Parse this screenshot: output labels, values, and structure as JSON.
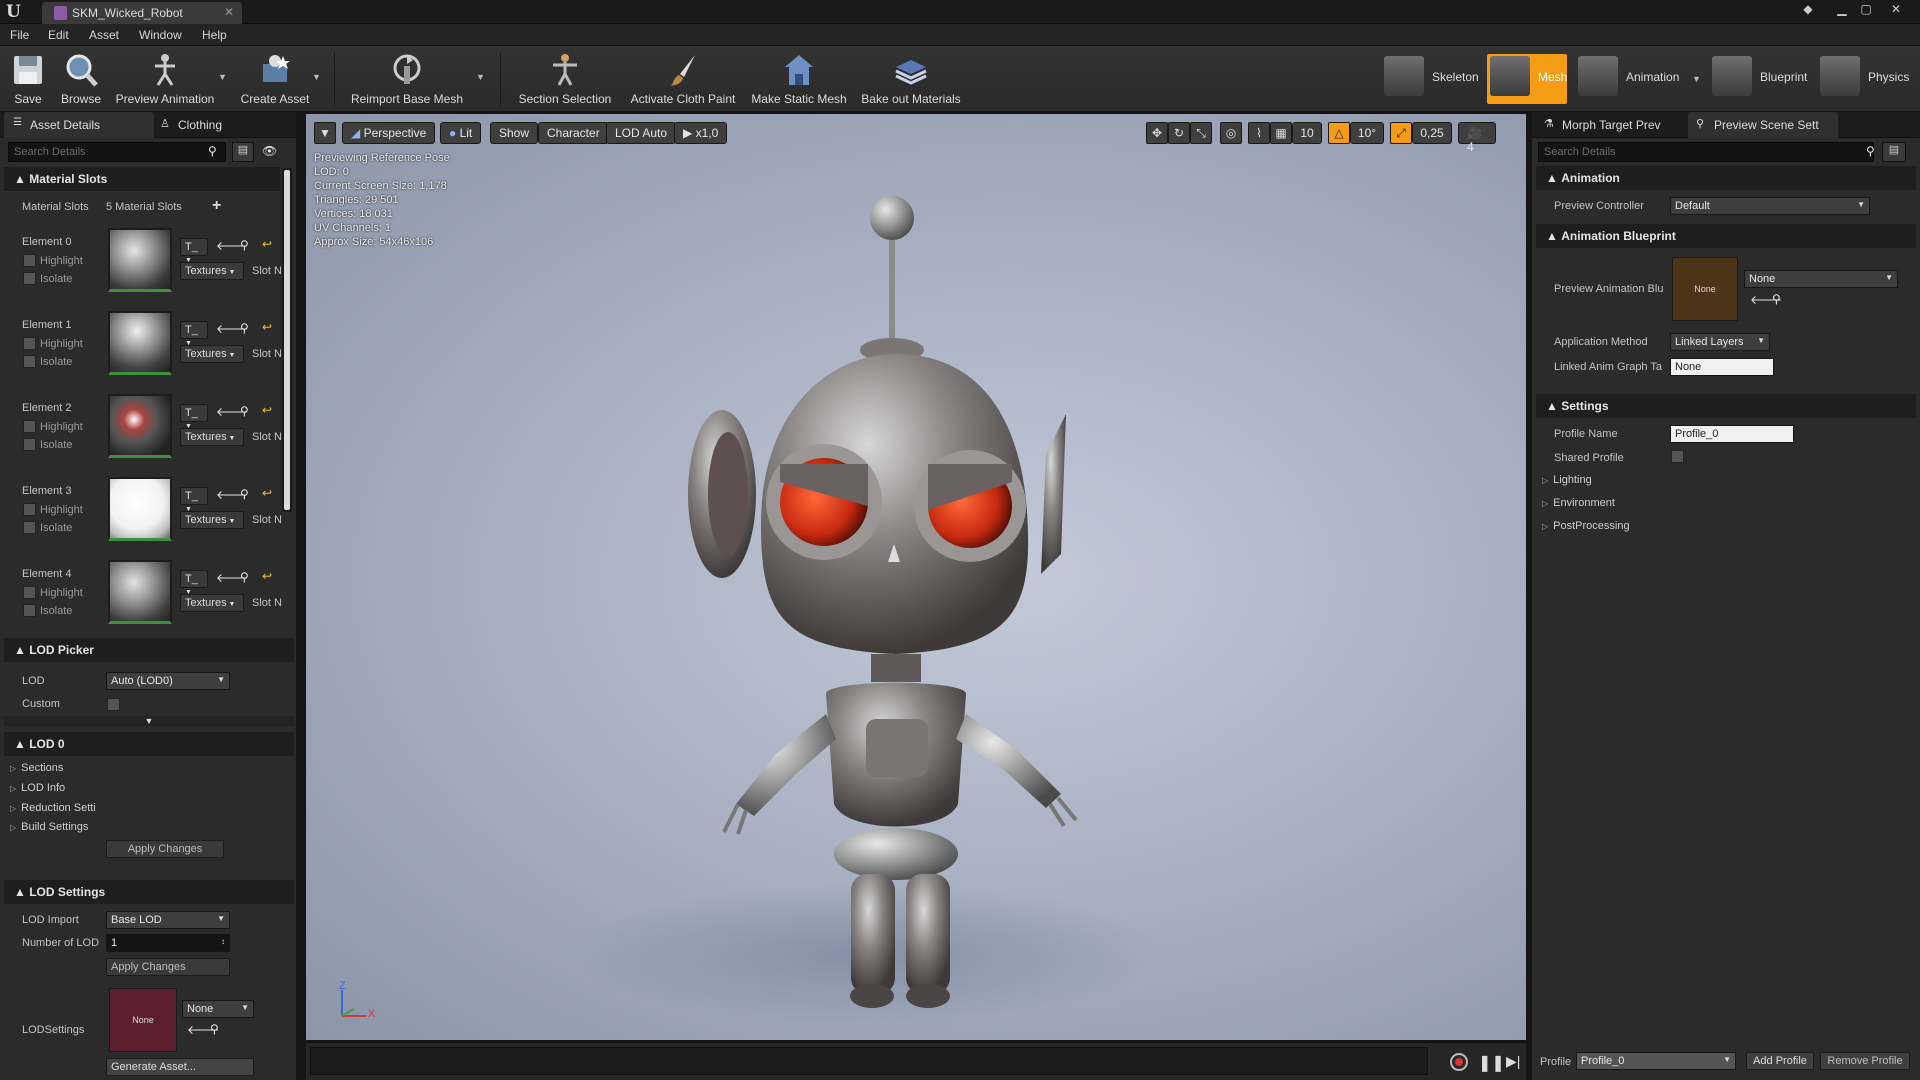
{
  "title_bar": {
    "document_tab": "SKM_Wicked_Robot"
  },
  "menu": [
    "File",
    "Edit",
    "Asset",
    "Window",
    "Help"
  ],
  "toolbar": {
    "save": "Save",
    "browse": "Browse",
    "preview_animation": "Preview Animation",
    "create_asset": "Create Asset",
    "reimport": "Reimport Base Mesh",
    "section_selection": "Section Selection",
    "activate_cloth": "Activate Cloth Paint",
    "make_static_mesh": "Make Static Mesh",
    "bake_materials": "Bake out Materials"
  },
  "modes": {
    "skeleton": "Skeleton",
    "mesh": "Mesh",
    "animation": "Animation",
    "blueprint": "Blueprint",
    "physics": "Physics",
    "active": "Mesh",
    "active_color": "#f49c16"
  },
  "left_panel": {
    "tabs": [
      "Asset Details",
      "Clothing"
    ],
    "search_placeholder": "Search Details",
    "material_slots": {
      "header": "Material Slots",
      "label": "Material Slots",
      "count": "5 Material Slots",
      "elements": [
        {
          "name": "Element 0",
          "highlight": "Highlight",
          "isolate": "Isolate",
          "picker": "T_",
          "textures": "Textures",
          "slot": "Slot N"
        },
        {
          "name": "Element 1",
          "highlight": "Highlight",
          "isolate": "Isolate",
          "picker": "T_",
          "textures": "Textures",
          "slot": "Slot N"
        },
        {
          "name": "Element 2",
          "highlight": "Highlight",
          "isolate": "Isolate",
          "picker": "T_",
          "textures": "Textures",
          "slot": "Slot N"
        },
        {
          "name": "Element 3",
          "highlight": "Highlight",
          "isolate": "Isolate",
          "picker": "T_",
          "textures": "Textures",
          "slot": "Slot Nan"
        },
        {
          "name": "Element 4",
          "highlight": "Highlight",
          "isolate": "Isolate",
          "picker": "T_",
          "textures": "Textures",
          "slot": "Slot Nan"
        }
      ]
    },
    "lod_picker": {
      "header": "LOD Picker",
      "lod_label": "LOD",
      "lod_value": "Auto (LOD0)",
      "custom_label": "Custom"
    },
    "lod0": {
      "header": "LOD 0",
      "items": [
        "Sections",
        "LOD Info",
        "Reduction Setti",
        "Build Settings"
      ],
      "apply": "Apply Changes"
    },
    "lod_settings": {
      "header": "LOD Settings",
      "import_label": "LOD Import",
      "import_value": "Base LOD",
      "number_label": "Number of LOD",
      "number_value": "1",
      "apply": "Apply Changes",
      "settings_label": "LODSettings",
      "none_thumb": "None",
      "none_combo": "None",
      "generate": "Generate Asset..."
    }
  },
  "viewport": {
    "buttons": {
      "perspective": "Perspective",
      "lit": "Lit",
      "show": "Show",
      "character": "Character",
      "lod": "LOD Auto",
      "speed": "x1,0"
    },
    "snap": {
      "grid": "10",
      "angle": "10°",
      "scale": "0,25",
      "camera": "4"
    },
    "info": [
      "Previewing Reference Pose",
      "LOD: 0",
      "Current Screen Size: 1,178",
      "Triangles: 29 501",
      "Vertices: 18 031",
      "UV Channels: 1",
      "Approx Size: 54x46x106"
    ],
    "axis": {
      "z": "Z",
      "x": "X"
    }
  },
  "right_panel": {
    "tabs": [
      "Morph Target Prev",
      "Preview Scene Sett"
    ],
    "search_placeholder": "Search Details",
    "animation": {
      "header": "Animation",
      "controller_label": "Preview Controller",
      "controller_value": "Default"
    },
    "anim_bp": {
      "header": "Animation Blueprint",
      "preview_label": "Preview Animation Blu",
      "thumb": "None",
      "combo": "None",
      "method_label": "Application Method",
      "method_value": "Linked Layers",
      "linked_label": "Linked Anim Graph Ta",
      "linked_value": "None"
    },
    "settings": {
      "header": "Settings",
      "profile_label": "Profile Name",
      "profile_value": "Profile_0",
      "shared_label": "Shared Profile",
      "items": [
        "Lighting",
        "Environment",
        "PostProcessing"
      ]
    },
    "footer": {
      "profile_label": "Profile",
      "profile_value": "Profile_0",
      "add": "Add Profile",
      "remove": "Remove Profile"
    }
  }
}
